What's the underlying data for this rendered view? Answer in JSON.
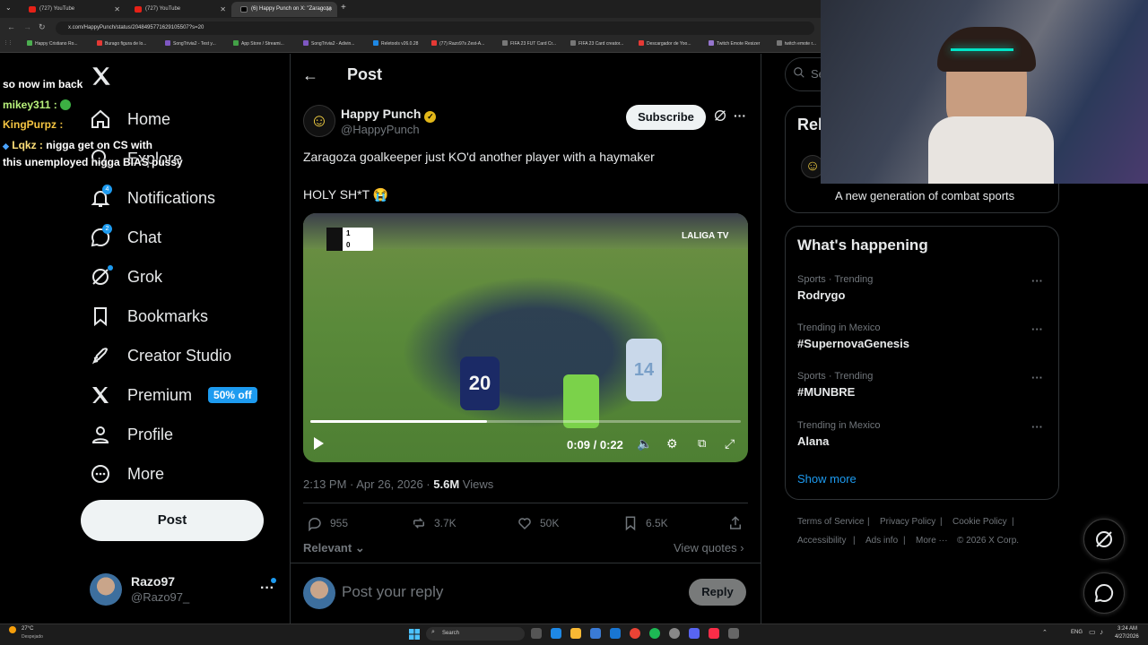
{
  "browser": {
    "tabs": [
      {
        "label": "(727) YouTube"
      },
      {
        "label": "(727) YouTube"
      },
      {
        "label": "(6) Happy Punch on X: \"Zaragoza"
      }
    ],
    "url": "x.com/HappyPunch/status/2048495771629105507?s=20",
    "bookmarks": [
      "Happy Cristiano Ro...",
      "Burago figura de lo...",
      "SongTrivia2 - Test y...",
      "App Store / Streami...",
      "SongTrivia2 - Adivin...",
      "Reletools v26.0.28",
      "(77) Razo97s Zest-A...",
      "FIFA 23 FUT Card Cr...",
      "FIFA 23 Card creator...",
      "Descargador de Yoo...",
      "Twitch Emote Resizer",
      "twitch emote r..."
    ]
  },
  "chat_overlay": [
    {
      "user": "",
      "text": "so now im back"
    },
    {
      "user": "mikey311 :",
      "text": ""
    },
    {
      "user": "KingPurpz :",
      "text": ""
    },
    {
      "user": "Lqkz :",
      "text": "nigga get on CS with"
    },
    {
      "user": "",
      "text": "this unemployed nigga BIAS pussy"
    }
  ],
  "sidebar": {
    "items": [
      {
        "label": "Home"
      },
      {
        "label": "Explore"
      },
      {
        "label": "Notifications",
        "badge": "4"
      },
      {
        "label": "Chat",
        "badge": "2"
      },
      {
        "label": "Grok"
      },
      {
        "label": "Bookmarks"
      },
      {
        "label": "Creator Studio"
      },
      {
        "label": "Premium",
        "badge": "50% off"
      },
      {
        "label": "Profile"
      },
      {
        "label": "More"
      }
    ],
    "post_label": "Post",
    "account": {
      "name": "Razo97",
      "handle": "@Razo97_"
    }
  },
  "post": {
    "header": "Post",
    "author_name": "Happy Punch",
    "author_handle": "@HappyPunch",
    "subscribe_label": "Subscribe",
    "text_line1": "Zaragoza goalkeeper just KO'd another player with a haymaker",
    "text_line2": "HOLY SH*T 😭",
    "video": {
      "time": "0:09 / 0:22",
      "progress": 0.41,
      "brand": "LALIGA TV",
      "score_home": "1",
      "score_away": "0"
    },
    "timestamp": "2:13 PM · Apr 26, 2026 · ",
    "views_count": "5.6M",
    "views_label": " Views",
    "actions": {
      "replies": "955",
      "reposts": "3.7K",
      "likes": "50K",
      "bookmarks": "6.5K"
    },
    "relevant_label": "Relevant",
    "view_quotes_label": "View quotes",
    "reply_placeholder": "Post your reply",
    "reply_button": "Reply"
  },
  "right": {
    "search_placeholder": "Se",
    "relevant_title": "Rel",
    "relevant_desc": "A new generation of combat sports",
    "trends_title": "What's happening",
    "trends": [
      {
        "category": "Sports · Trending",
        "name": "Rodrygo"
      },
      {
        "category": "Trending in Mexico",
        "name": "#SupernovaGenesis"
      },
      {
        "category": "Sports · Trending",
        "name": "#MUNBRE"
      },
      {
        "category": "Trending in Mexico",
        "name": "Alana"
      }
    ],
    "show_more": "Show more",
    "footer_links": [
      "Terms of Service",
      "Privacy Policy",
      "Cookie Policy",
      "Accessibility",
      "Ads info",
      "More ···",
      "© 2026 X Corp."
    ]
  },
  "taskbar": {
    "weather_temp": "27°C",
    "weather_desc": "Despejado",
    "search": "Search",
    "lang": "ENG",
    "time": "3:24 AM",
    "date": "4/27/2026"
  },
  "colors": {
    "accent": "#1d9bf0",
    "background": "#000000",
    "muted": "#71767b"
  }
}
